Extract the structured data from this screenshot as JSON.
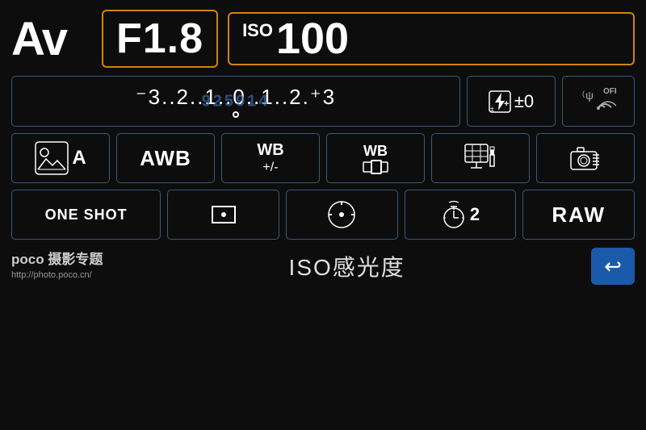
{
  "screen": {
    "background": "#0d0d0d"
  },
  "header": {
    "mode_label": "Av",
    "aperture_label": "F1.8",
    "iso_prefix": "ISO",
    "iso_value": "100"
  },
  "exposure": {
    "scale": "⁻3..2..1..0..1..2.⁺3",
    "scale_display": "-3..2..1..0̤..1..2.+3"
  },
  "flash": {
    "label": "⚡±0"
  },
  "wifi": {
    "label": "OFF"
  },
  "row3": {
    "scene": "☀A",
    "awb": "AWB",
    "wb_adj_top": "WB",
    "wb_adj_bot": "+/-",
    "wb_bracket": "WB",
    "display": "display",
    "camera": "camera"
  },
  "row4": {
    "one_shot": "ONE SHOT",
    "af": "af-point",
    "metering": "metering",
    "self_timer": "self-timer",
    "self_timer_num": "2",
    "raw": "RAW"
  },
  "bottom": {
    "poco_brand": "poco 摄影专题",
    "poco_url": "http://photo.poco.cn/",
    "iso_label": "ISO感光度"
  },
  "colors": {
    "border_active": "#d4820a",
    "border_normal": "#3a5a7a",
    "back_btn": "#1a5aaa",
    "text": "#ffffff",
    "dim_text": "#aaaaaa",
    "watermark": "#3a6aaa"
  }
}
